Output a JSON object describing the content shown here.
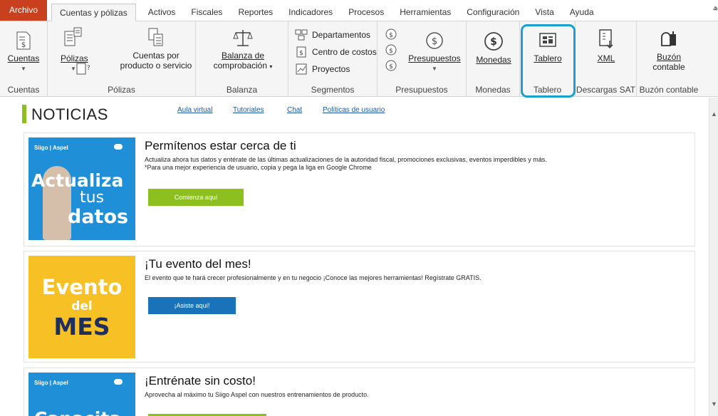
{
  "tabs": [
    "Archivo",
    "Cuentas y pólizas",
    "Activos",
    "Fiscales",
    "Reportes",
    "Indicadores",
    "Procesos",
    "Herramientas",
    "Configuración",
    "Vista",
    "Ayuda"
  ],
  "ribbon": {
    "cuentas": {
      "button": "Cuentas",
      "group": "Cuentas"
    },
    "polizas": {
      "button": "Pólizas",
      "cuentas_line1": "Cuentas por",
      "cuentas_line2": "producto o servicio",
      "group": "Pólizas"
    },
    "balanza": {
      "line1": "Balanza de",
      "line2": "comprobación",
      "group": "Balanza"
    },
    "segmentos": {
      "departamentos": "Departamentos",
      "centro": "Centro de costos",
      "proyectos": "Proyectos",
      "group": "Segmentos"
    },
    "presupuestos": {
      "button": "Presupuestos",
      "group": "Presupuestos"
    },
    "monedas": {
      "button": "Monedas",
      "group": "Monedas"
    },
    "tablero": {
      "button": "Tablero",
      "group": "Tablero"
    },
    "descargas": {
      "button": "XML",
      "group": "Descargas SAT"
    },
    "buzon": {
      "line1": "Buzón",
      "line2": "contable",
      "group": "Buzón contable"
    }
  },
  "news": {
    "title": "NOTICIAS",
    "links": [
      "Aula virtual",
      "Tutoriales",
      "Chat",
      "Políticas de usuario"
    ]
  },
  "cards": [
    {
      "title": "Permítenos estar cerca de ti",
      "desc1": "Actualiza ahora tus datos y entérate de las últimas actualizaciones de la autoridad fiscal, promociones exclusivas, eventos imperdibles y más.",
      "desc2": "*Para una mejor experiencia de usuario, copia y pega la liga en Google Chrome",
      "cta": "Comienza aquí",
      "img_brand1": "Siigo",
      "img_brand2": "Aspel",
      "img_line1": "Actualiza",
      "img_line2": "tus",
      "img_line3": "datos"
    },
    {
      "title": "¡Tu evento del mes!",
      "desc1": "El evento que te hará crecer profesionalmente y en tu negocio ¡Conoce las mejores herramientas! Regístrate GRATIS.",
      "cta": "¡Asiste aquí!",
      "img_line1": "Evento",
      "img_line2": "del",
      "img_line3": "MES"
    },
    {
      "title": "¡Entrénate sin costo!",
      "desc1": "Aprovecha al máximo tu Siigo Aspel con nuestros entrenamientos de producto.",
      "img_brand1": "Siigo",
      "img_brand2": "Aspel",
      "img_line1": "Capacita"
    }
  ],
  "colors": {
    "accent_green": "#8dbf1e",
    "accent_blue": "#1a73b8",
    "card_blue": "#1f8fd8",
    "card_yellow": "#f7c024",
    "highlight": "#1aa0cf",
    "archivo": "#c8401d"
  }
}
